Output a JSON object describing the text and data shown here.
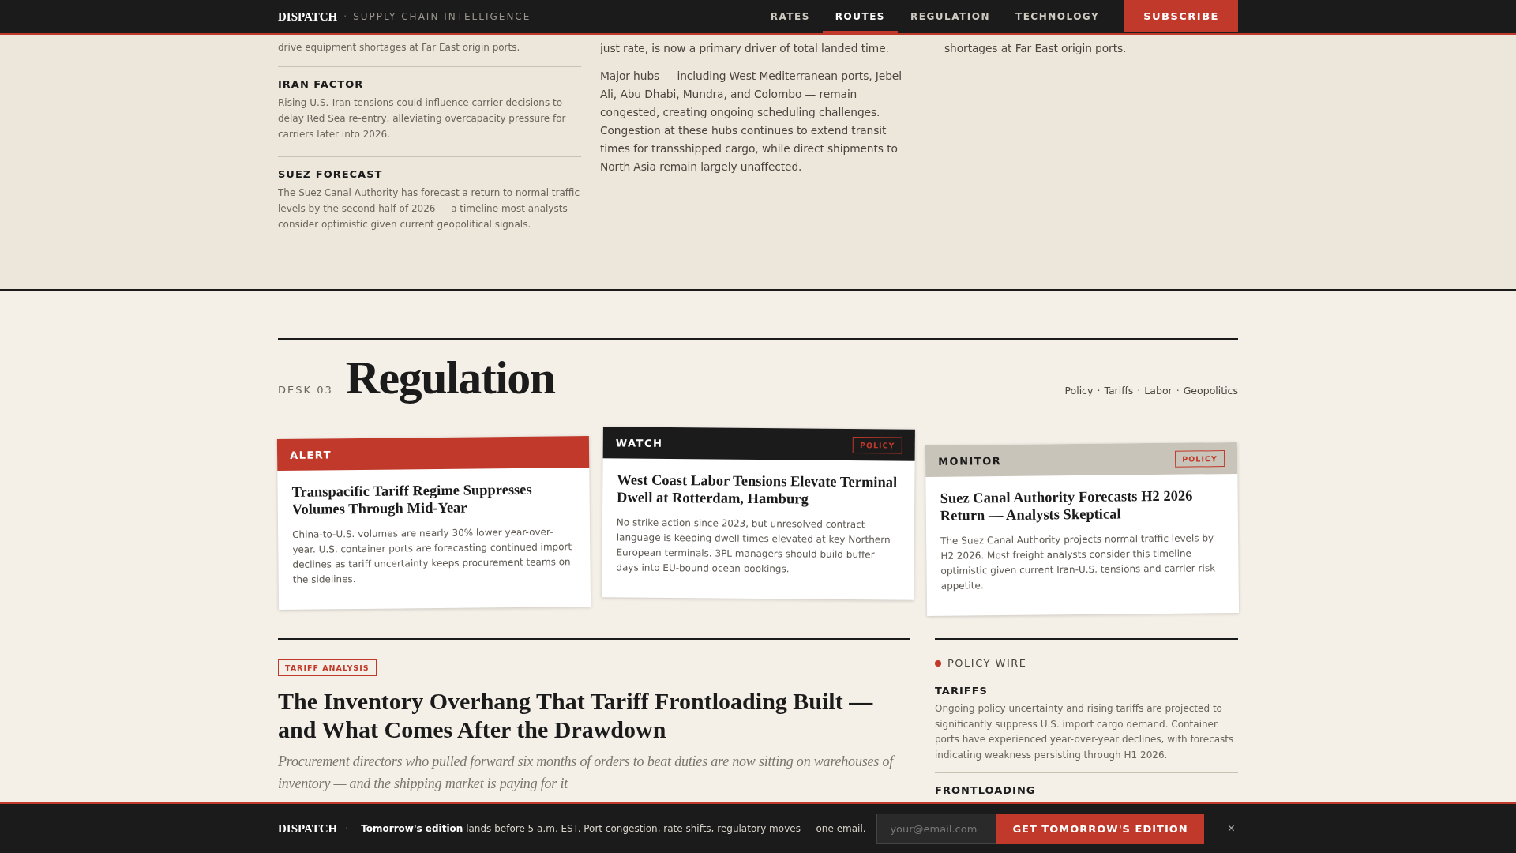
{
  "header": {
    "brand": "DISPATCH",
    "separator": "·",
    "tagline": "SUPPLY CHAIN INTELLIGENCE",
    "nav": [
      {
        "label": "RATES",
        "selected": false
      },
      {
        "label": "ROUTES",
        "selected": true
      },
      {
        "label": "REGULATION",
        "selected": false
      },
      {
        "label": "TECHNOLOGY",
        "selected": false
      }
    ],
    "subscribe": "SUBSCRIBE"
  },
  "routes_section": {
    "briefs_lead": "drive equipment shortages at Far East origin ports.",
    "briefs": [
      {
        "title": "IRAN FACTOR",
        "text": "Rising U.S.-Iran tensions could influence carrier decisions to delay Red Sea re-entry, alleviating overcapacity pressure for carriers later into 2026."
      },
      {
        "title": "SUEZ FORECAST",
        "text": "The Suez Canal Authority has forecast a return to normal traffic levels by the second half of 2026 — a timeline most analysts consider optimistic given current geopolitical signals."
      }
    ],
    "body_paragraphs": [
      "just rate, is now a primary driver of total landed time.",
      "Major hubs — including West Mediterranean ports, Jebel Ali, Abu Dhabi, Mundra, and Colombo — remain congested, creating ongoing scheduling challenges. Congestion at these hubs continues to extend transit times for transshipped cargo, while direct shipments to North Asia remain largely unaffected."
    ],
    "sidebar_text": "shortages at Far East origin ports."
  },
  "regulation_section": {
    "desk": "DESK 03",
    "title": "Regulation",
    "separator": "·",
    "topics": [
      "Policy",
      "Tariffs",
      "Labor",
      "Geopolitics"
    ],
    "cards": [
      {
        "kind": "alert",
        "label": "ALERT",
        "headline": "Transpacific Tariff Regime Suppresses Volumes Through Mid-Year",
        "text": "China-to-U.S. volumes are nearly 30% lower year-over-year. U.S. container ports are forecasting continued import declines as tariff uncertainty keeps procurement teams on the sidelines."
      },
      {
        "kind": "watch",
        "label": "WATCH",
        "tag": "POLICY",
        "headline": "West Coast Labor Tensions Elevate Terminal Dwell at Rotterdam, Hamburg",
        "text": "No strike action since 2023, but unresolved contract language is keeping dwell times elevated at key Northern European terminals. 3PL managers should build buffer days into EU-bound ocean bookings."
      },
      {
        "kind": "monitor",
        "label": "MONITOR",
        "tag": "POLICY",
        "headline": "Suez Canal Authority Forecasts H2 2026 Return — Analysts Skeptical",
        "text": "The Suez Canal Authority projects normal traffic levels by H2 2026. Most freight analysts consider this timeline optimistic given current Iran-U.S. tensions and carrier risk appetite."
      }
    ],
    "feature": {
      "tag": "TARIFF ANALYSIS",
      "headline": "The Inventory Overhang That Tariff Frontloading Built — and What Comes After the Drawdown",
      "deck": "Procurement directors who pulled forward six months of orders to beat duties are now sitting on warehouses of inventory — and the shipping market is paying for it"
    },
    "wire": {
      "title": "POLICY WIRE",
      "items": [
        {
          "title": "TARIFFS",
          "text": "Ongoing policy uncertainty and rising tariffs are projected to significantly suppress U.S. import cargo demand. Container ports have experienced year-over-year declines, with forecasts indicating weakness persisting through H1 2026."
        },
        {
          "title": "FRONTLOADING"
        }
      ]
    }
  },
  "newsletter_bar": {
    "brand": "DISPATCH",
    "separator": "·",
    "text": "**Tomorrow's edition** lands before 5 a.m. EST. Port congestion, rate shifts, regulatory moves — one email.",
    "email_placeholder": "your@email.com",
    "button": "GET TOMORROW'S EDITION",
    "close": "×"
  }
}
